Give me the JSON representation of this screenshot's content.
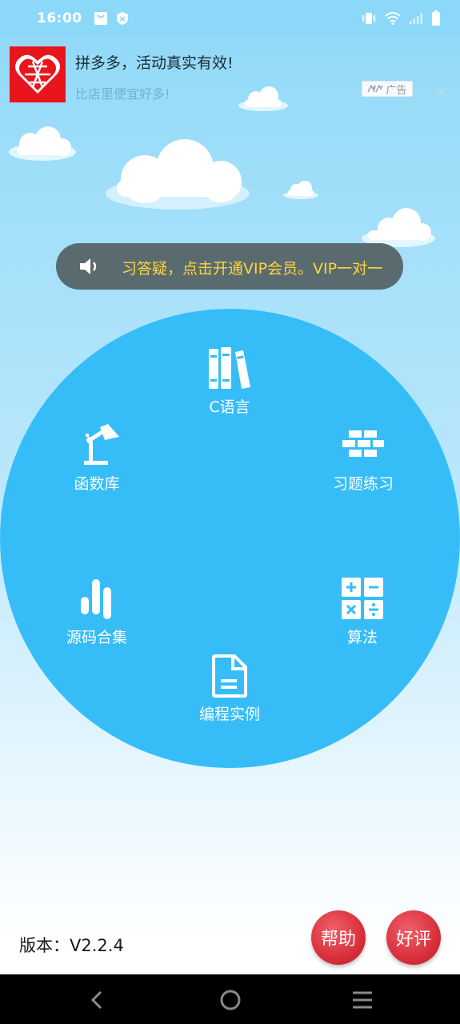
{
  "status_bar": {
    "time": "16:00",
    "icons_left": [
      "shopping-bag-icon",
      "shield-icon"
    ],
    "icons_right": [
      "vibrate-icon",
      "wifi-icon",
      "signal-icon",
      "battery-icon"
    ]
  },
  "ad": {
    "logo_text": "拼",
    "title": "拼多多，活动真实有效!",
    "subtitle": "比店里便宜好多!",
    "tag": "广告",
    "brand_color": "#e8151c"
  },
  "notice": {
    "text": "习答疑，点击开通VIP会员。VIP一对一"
  },
  "menu": {
    "items": [
      {
        "label": "C语言",
        "icon": "books-icon"
      },
      {
        "label": "函数库",
        "icon": "lamp-icon"
      },
      {
        "label": "习题练习",
        "icon": "bricks-icon"
      },
      {
        "label": "源码合集",
        "icon": "bars-icon"
      },
      {
        "label": "算法",
        "icon": "calculator-icon"
      },
      {
        "label": "编程实例",
        "icon": "document-icon"
      }
    ],
    "circle_color": "#36bdf8"
  },
  "footer": {
    "version": "版本：V2.2.4",
    "help_label": "帮助",
    "review_label": "好评",
    "button_color": "#d8303b"
  },
  "nav": {
    "icons": [
      "back-icon",
      "home-icon",
      "menu-icon"
    ]
  }
}
